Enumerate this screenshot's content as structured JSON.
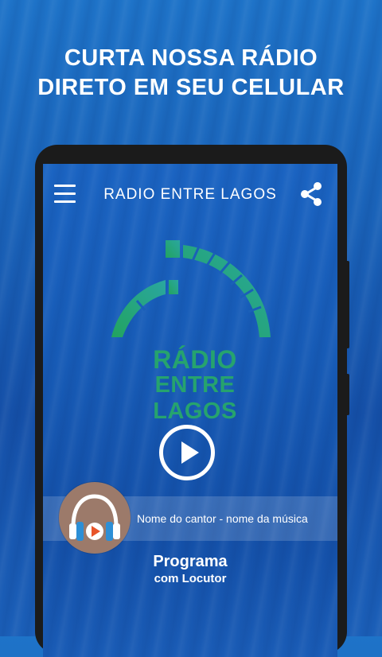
{
  "promo": {
    "line1": "CURTA NOSSA RÁDIO",
    "line2": "DIRETO EM SEU CELULAR"
  },
  "app": {
    "title": "RADIO ENTRE LAGOS",
    "menu_icon": "hamburger-menu-icon",
    "share_icon": "share-icon"
  },
  "logo": {
    "line1": "RÁDIO",
    "line2": "ENTRE LAGOS",
    "color": "#26a36e"
  },
  "player": {
    "play_icon": "play-icon",
    "now_playing": "Nome do cantor - nome da música",
    "cover_icon": "headphones-play-icon"
  },
  "program": {
    "name": "Programa",
    "host": "com Locutor"
  },
  "colors": {
    "background": "#1a62b8",
    "phone_frame": "#1b1b1b",
    "accent_green": "#26a36e",
    "cover_bg": "#9c7a6a",
    "headphone_blue": "#2d8fd6",
    "play_orange": "#e8552a"
  }
}
